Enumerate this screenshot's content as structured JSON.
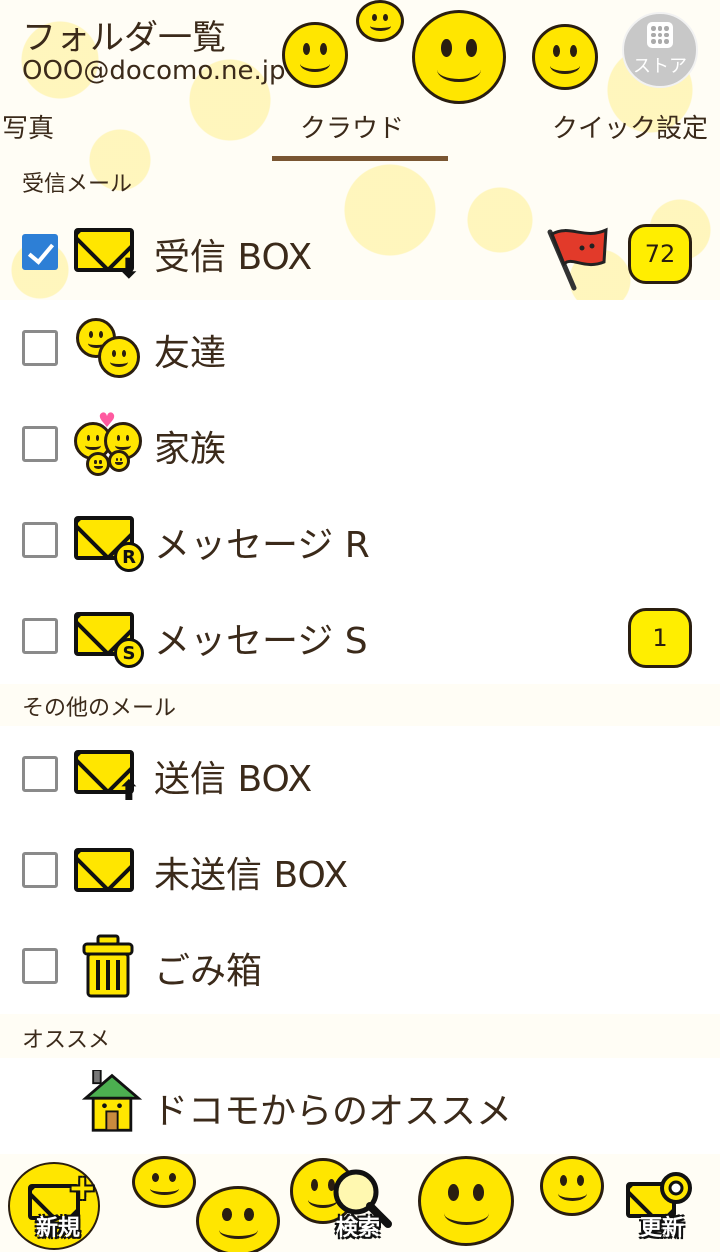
{
  "header": {
    "title": "フォルダ一覧",
    "account": "OOO@docomo.ne.jp",
    "store_label": "ストア"
  },
  "tabs": [
    {
      "label": "写真",
      "selected": false
    },
    {
      "label": "クラウド",
      "selected": true
    },
    {
      "label": "クイック設定",
      "selected": false
    }
  ],
  "sections": {
    "inbox_section": "受信メール",
    "other_section": "その他のメール",
    "recommend_section": "オススメ"
  },
  "folders": [
    {
      "name": "受信 BOX",
      "checked": true,
      "icon": "inbox-envelope-icon",
      "badge": "72",
      "flag": true
    },
    {
      "name": "友達",
      "checked": false,
      "icon": "friends-smiley-icon",
      "badge": "",
      "flag": false
    },
    {
      "name": "家族",
      "checked": false,
      "icon": "family-smiley-icon",
      "badge": "",
      "flag": false
    },
    {
      "name": "メッセージ R",
      "checked": false,
      "icon": "message-r-envelope-icon",
      "badge": "",
      "flag": false
    },
    {
      "name": "メッセージ S",
      "checked": false,
      "icon": "message-s-envelope-icon",
      "badge": "1",
      "flag": false
    }
  ],
  "other_folders": [
    {
      "name": "送信 BOX",
      "checked": false,
      "icon": "sent-envelope-icon"
    },
    {
      "name": "未送信 BOX",
      "checked": false,
      "icon": "unsent-envelope-icon"
    },
    {
      "name": "ごみ箱",
      "checked": false,
      "icon": "trash-icon"
    }
  ],
  "recommend": {
    "name": "ドコモからのオススメ",
    "icon": "house-smiley-icon"
  },
  "bottom_bar": {
    "new_label": "新規",
    "search_label": "検索",
    "refresh_label": "更新"
  },
  "colors": {
    "accent_yellow": "#ffe600",
    "text_brown": "#3b2a1a",
    "tab_underline": "#7a5632",
    "checkbox_blue": "#2d7fd6"
  }
}
